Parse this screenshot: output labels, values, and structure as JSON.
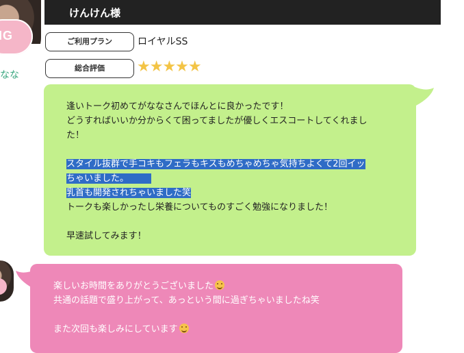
{
  "cast": {
    "name_fragment": "なな",
    "badge_text": "NG",
    "badge_text_small": "G"
  },
  "review": {
    "customer": "けんけん様",
    "plan_label": "ご利用プラン",
    "plan_value": "ロイヤルSS",
    "rating_label": "総合評価",
    "stars_display": "★★★★★",
    "rating": 5,
    "lines": [
      "逢いトーク初めてがななさんでほんとに良かったです！",
      "どうすればいいか分からくて困ってましたが優しくエスコートしてくれまし",
      "た！",
      "",
      "スタイル抜群で手コキもフェラもキスもめちゃめちゃ気持ちよくて2回イッ",
      "ちゃいました。",
      "乳首も開発されちゃいました笑",
      "トークも楽しかったし栄養についてものすごく勉強になりました！",
      "",
      "早速試してみます！"
    ]
  },
  "reply": {
    "line1": "楽しいお時間をありがとうございました",
    "line2": "共通の話題で盛り上がって、あっという間に過ぎちゃいましたね笑",
    "line3": "",
    "line4": "また次回も楽しみにしています"
  },
  "colors": {
    "header_bg": "#222222",
    "review_bubble": "#c3f08c",
    "reply_bubble": "#ee88b8",
    "star": "#f3c446",
    "highlight": "#2f6cc6"
  },
  "icons": {
    "emoji": "smiling-face-icon",
    "avatar": "cast-avatar-icon"
  }
}
